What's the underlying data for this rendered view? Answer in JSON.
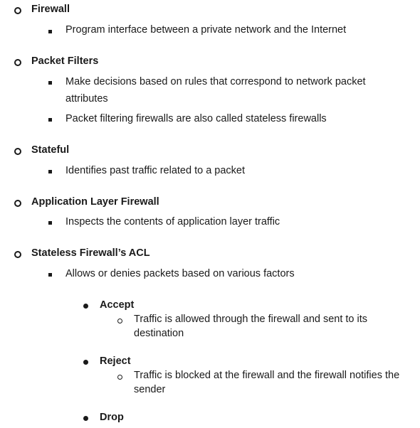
{
  "sections": [
    {
      "heading": "Firewall",
      "items": [
        "Program interface between a private network and the Internet"
      ]
    },
    {
      "heading": "Packet Filters",
      "items": [
        [
          "Make decisions based on rules that correspond to network packet",
          "attributes"
        ],
        "Packet filtering firewalls are also called stateless firewalls"
      ]
    },
    {
      "heading": "Stateful",
      "items": [
        "Identifies past traffic related to a packet"
      ]
    },
    {
      "heading": "Application Layer Firewall",
      "items": [
        "Inspects the contents of application layer traffic"
      ]
    },
    {
      "heading": "Stateless Firewall’s ACL",
      "items": [
        "Allows or denies packets based on various factors"
      ]
    }
  ],
  "actions": [
    {
      "name": "Accept",
      "detail": [
        "Traffic is allowed through the firewall and sent to its",
        "destination"
      ]
    },
    {
      "name": "Reject",
      "detail": [
        "Traffic is blocked at the firewall and the firewall notifies the",
        "sender"
      ]
    },
    {
      "name": "Drop"
    }
  ]
}
